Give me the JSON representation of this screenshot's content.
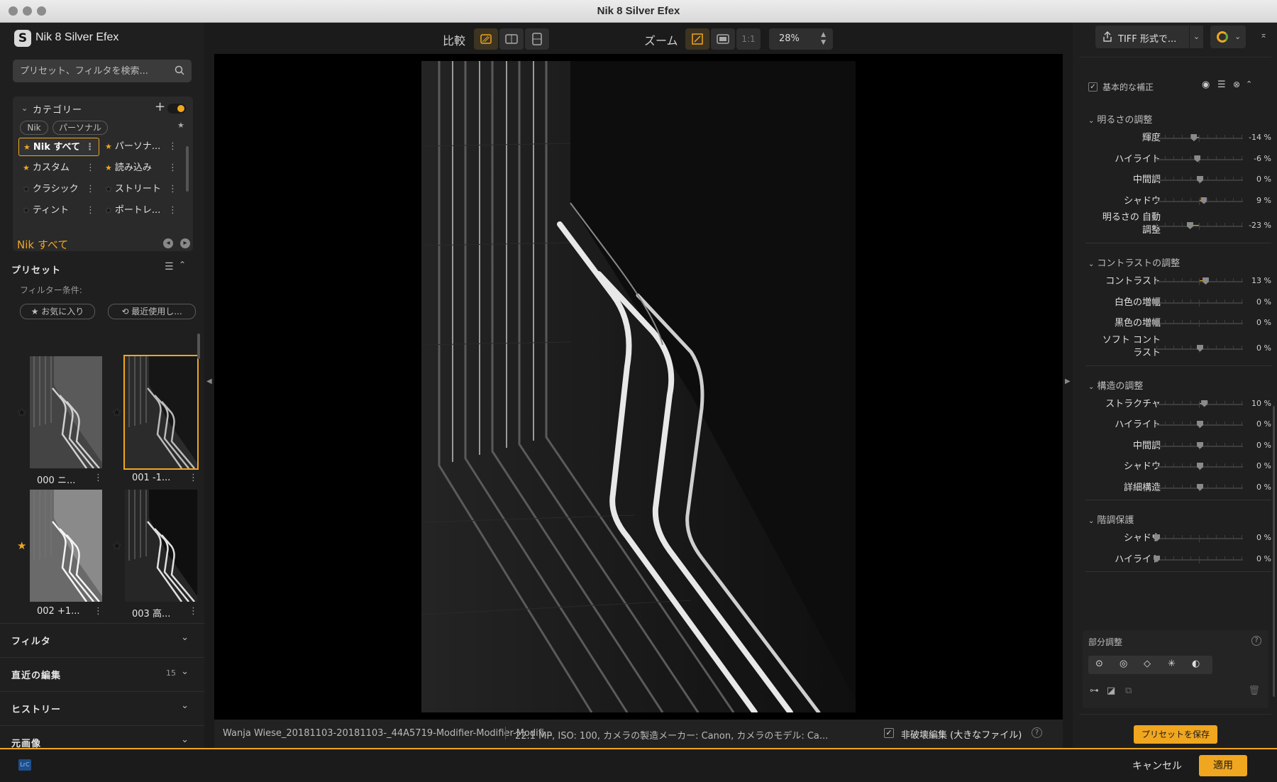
{
  "window": {
    "title": "Nik 8 Silver Efex"
  },
  "app": {
    "name": "Nik 8 Silver Efex",
    "logo_letter": "S"
  },
  "search": {
    "placeholder": "プリセット、フィルタを検索..."
  },
  "categories": {
    "header": "カテゴリー",
    "pills": [
      "Nik",
      "パーソナル"
    ],
    "items": [
      {
        "label": "Nik すべて",
        "star_color": "#f0a61f",
        "selected": true
      },
      {
        "label": "パーソナ...",
        "star_color": "#f0a61f",
        "selected": false
      },
      {
        "label": "カスタム",
        "star_color": "#f0a61f",
        "selected": false
      },
      {
        "label": "読み込み",
        "star_color": "#f0a61f",
        "selected": false
      },
      {
        "label": "クラシック",
        "star_color": "#111111",
        "selected": false
      },
      {
        "label": "ストリート",
        "star_color": "#111111",
        "selected": false
      },
      {
        "label": "ティント",
        "star_color": "#111111",
        "selected": false
      },
      {
        "label": "ポートレ...",
        "star_color": "#111111",
        "selected": false
      }
    ]
  },
  "current_category": "Nik すべて",
  "presets": {
    "header": "プリセット",
    "filter_label": "フィルター条件:",
    "filter_chips": [
      "お気に入り",
      "最近使用し..."
    ],
    "thumbs": [
      {
        "label": "000 ニ...",
        "favorite": false,
        "selected": false
      },
      {
        "label": "001 -1...",
        "favorite": false,
        "selected": true
      },
      {
        "label": "002 +1...",
        "favorite": true,
        "selected": false
      },
      {
        "label": "003 高...",
        "favorite": false,
        "selected": false
      }
    ]
  },
  "accordion": [
    {
      "label": "フィルタ",
      "count": ""
    },
    {
      "label": "直近の編集",
      "count": "15"
    },
    {
      "label": "ヒストリー",
      "count": ""
    },
    {
      "label": "元画像",
      "count": ""
    }
  ],
  "toolbar": {
    "compare_label": "比較",
    "zoom_label": "ズーム",
    "one_to_one": "1:1",
    "zoom_value": "28%"
  },
  "status": {
    "filename": "Wanja Wiese_20181103-20181103-_44A5719-Modifier-Modifier-Modifi...",
    "meta": "22.1 MP, ISO: 100, カメラの製造メーカー: Canon, カメラのモデル: Ca...",
    "nondestructive_label": "非破壊編集 (大きなファイル)",
    "nondestructive_checked": true
  },
  "export": {
    "label": "TIFF 形式で..."
  },
  "adjust": {
    "section_label": "基本的な補正",
    "groups": [
      {
        "title": "明るさの調整",
        "rows": [
          {
            "name": "輝度",
            "value": "-14 %",
            "pct": -14
          },
          {
            "name": "ハイライト",
            "value": "-6 %",
            "pct": -6
          },
          {
            "name": "中間調",
            "value": "0 %",
            "pct": 0
          },
          {
            "name": "シャドウ",
            "value": "9 %",
            "pct": 9
          },
          {
            "name": "明るさの 自動\n調整",
            "value": "-23 %",
            "pct": -23
          }
        ]
      },
      {
        "title": "コントラストの調整",
        "rows": [
          {
            "name": "コントラスト",
            "value": "13 %",
            "pct": 13
          },
          {
            "name": "白色の増幅",
            "value": "0 %",
            "pct": -100
          },
          {
            "name": "黒色の増幅",
            "value": "0 %",
            "pct": -100
          },
          {
            "name": "ソフト コント\nラスト",
            "value": "0 %",
            "pct": 0
          }
        ]
      },
      {
        "title": "構造の調整",
        "rows": [
          {
            "name": "ストラクチャ",
            "value": "10 %",
            "pct": 10
          },
          {
            "name": "ハイライト",
            "value": "0 %",
            "pct": 0
          },
          {
            "name": "中間調",
            "value": "0 %",
            "pct": 0
          },
          {
            "name": "シャドウ",
            "value": "0 %",
            "pct": 0
          },
          {
            "name": "詳細構造",
            "value": "0 %",
            "pct": 0
          }
        ]
      },
      {
        "title": "階調保護",
        "rows": [
          {
            "name": "シャドウ",
            "value": "0 %",
            "pct": -100
          },
          {
            "name": "ハイライト",
            "value": "0 %",
            "pct": -100
          }
        ]
      }
    ],
    "local_label": "部分調整"
  },
  "save_preset": "プリセットを保存",
  "bottom": {
    "lr_badge": "LrC",
    "cancel": "キャンセル",
    "apply": "適用"
  },
  "colors": {
    "accent": "#f0a61f",
    "panel": "#1f1f1f"
  }
}
